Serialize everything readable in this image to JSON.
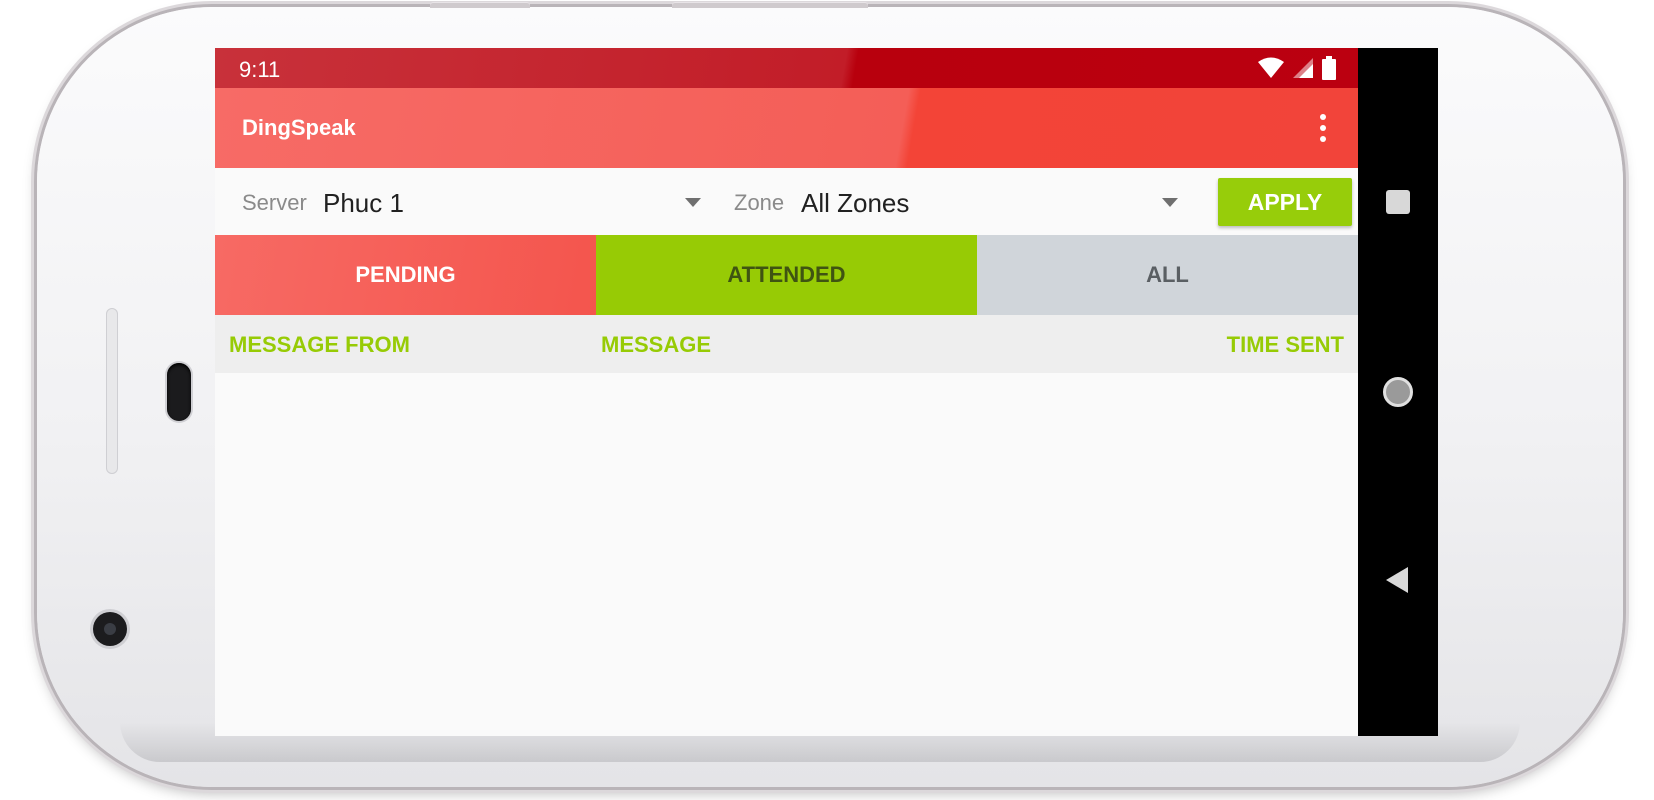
{
  "status_bar": {
    "time": "9:11",
    "icons": [
      "wifi-icon",
      "cell-signal-icon",
      "battery-icon"
    ]
  },
  "app_bar": {
    "title": "DingSpeak",
    "menu_icon": "overflow-menu-icon"
  },
  "filters": {
    "server_label": "Server",
    "server_value": "Phuc 1",
    "zone_label": "Zone",
    "zone_value": "All Zones",
    "apply_label": "APPLY"
  },
  "tabs": [
    {
      "label": "PENDING",
      "color": "#f4554d",
      "selected": true
    },
    {
      "label": "ATTENDED",
      "color": "#97cb05",
      "selected": false
    },
    {
      "label": "ALL",
      "color": "#d0d5da",
      "selected": false
    }
  ],
  "list": {
    "columns": [
      "MESSAGE FROM",
      "MESSAGE",
      "TIME SENT"
    ],
    "rows": []
  },
  "nav_bar": {
    "buttons": [
      "recents-icon",
      "home-icon",
      "back-icon"
    ]
  },
  "colors": {
    "accent_red": "#f44336",
    "accent_green": "#97cb05",
    "status_bar_red": "#bb0010"
  }
}
